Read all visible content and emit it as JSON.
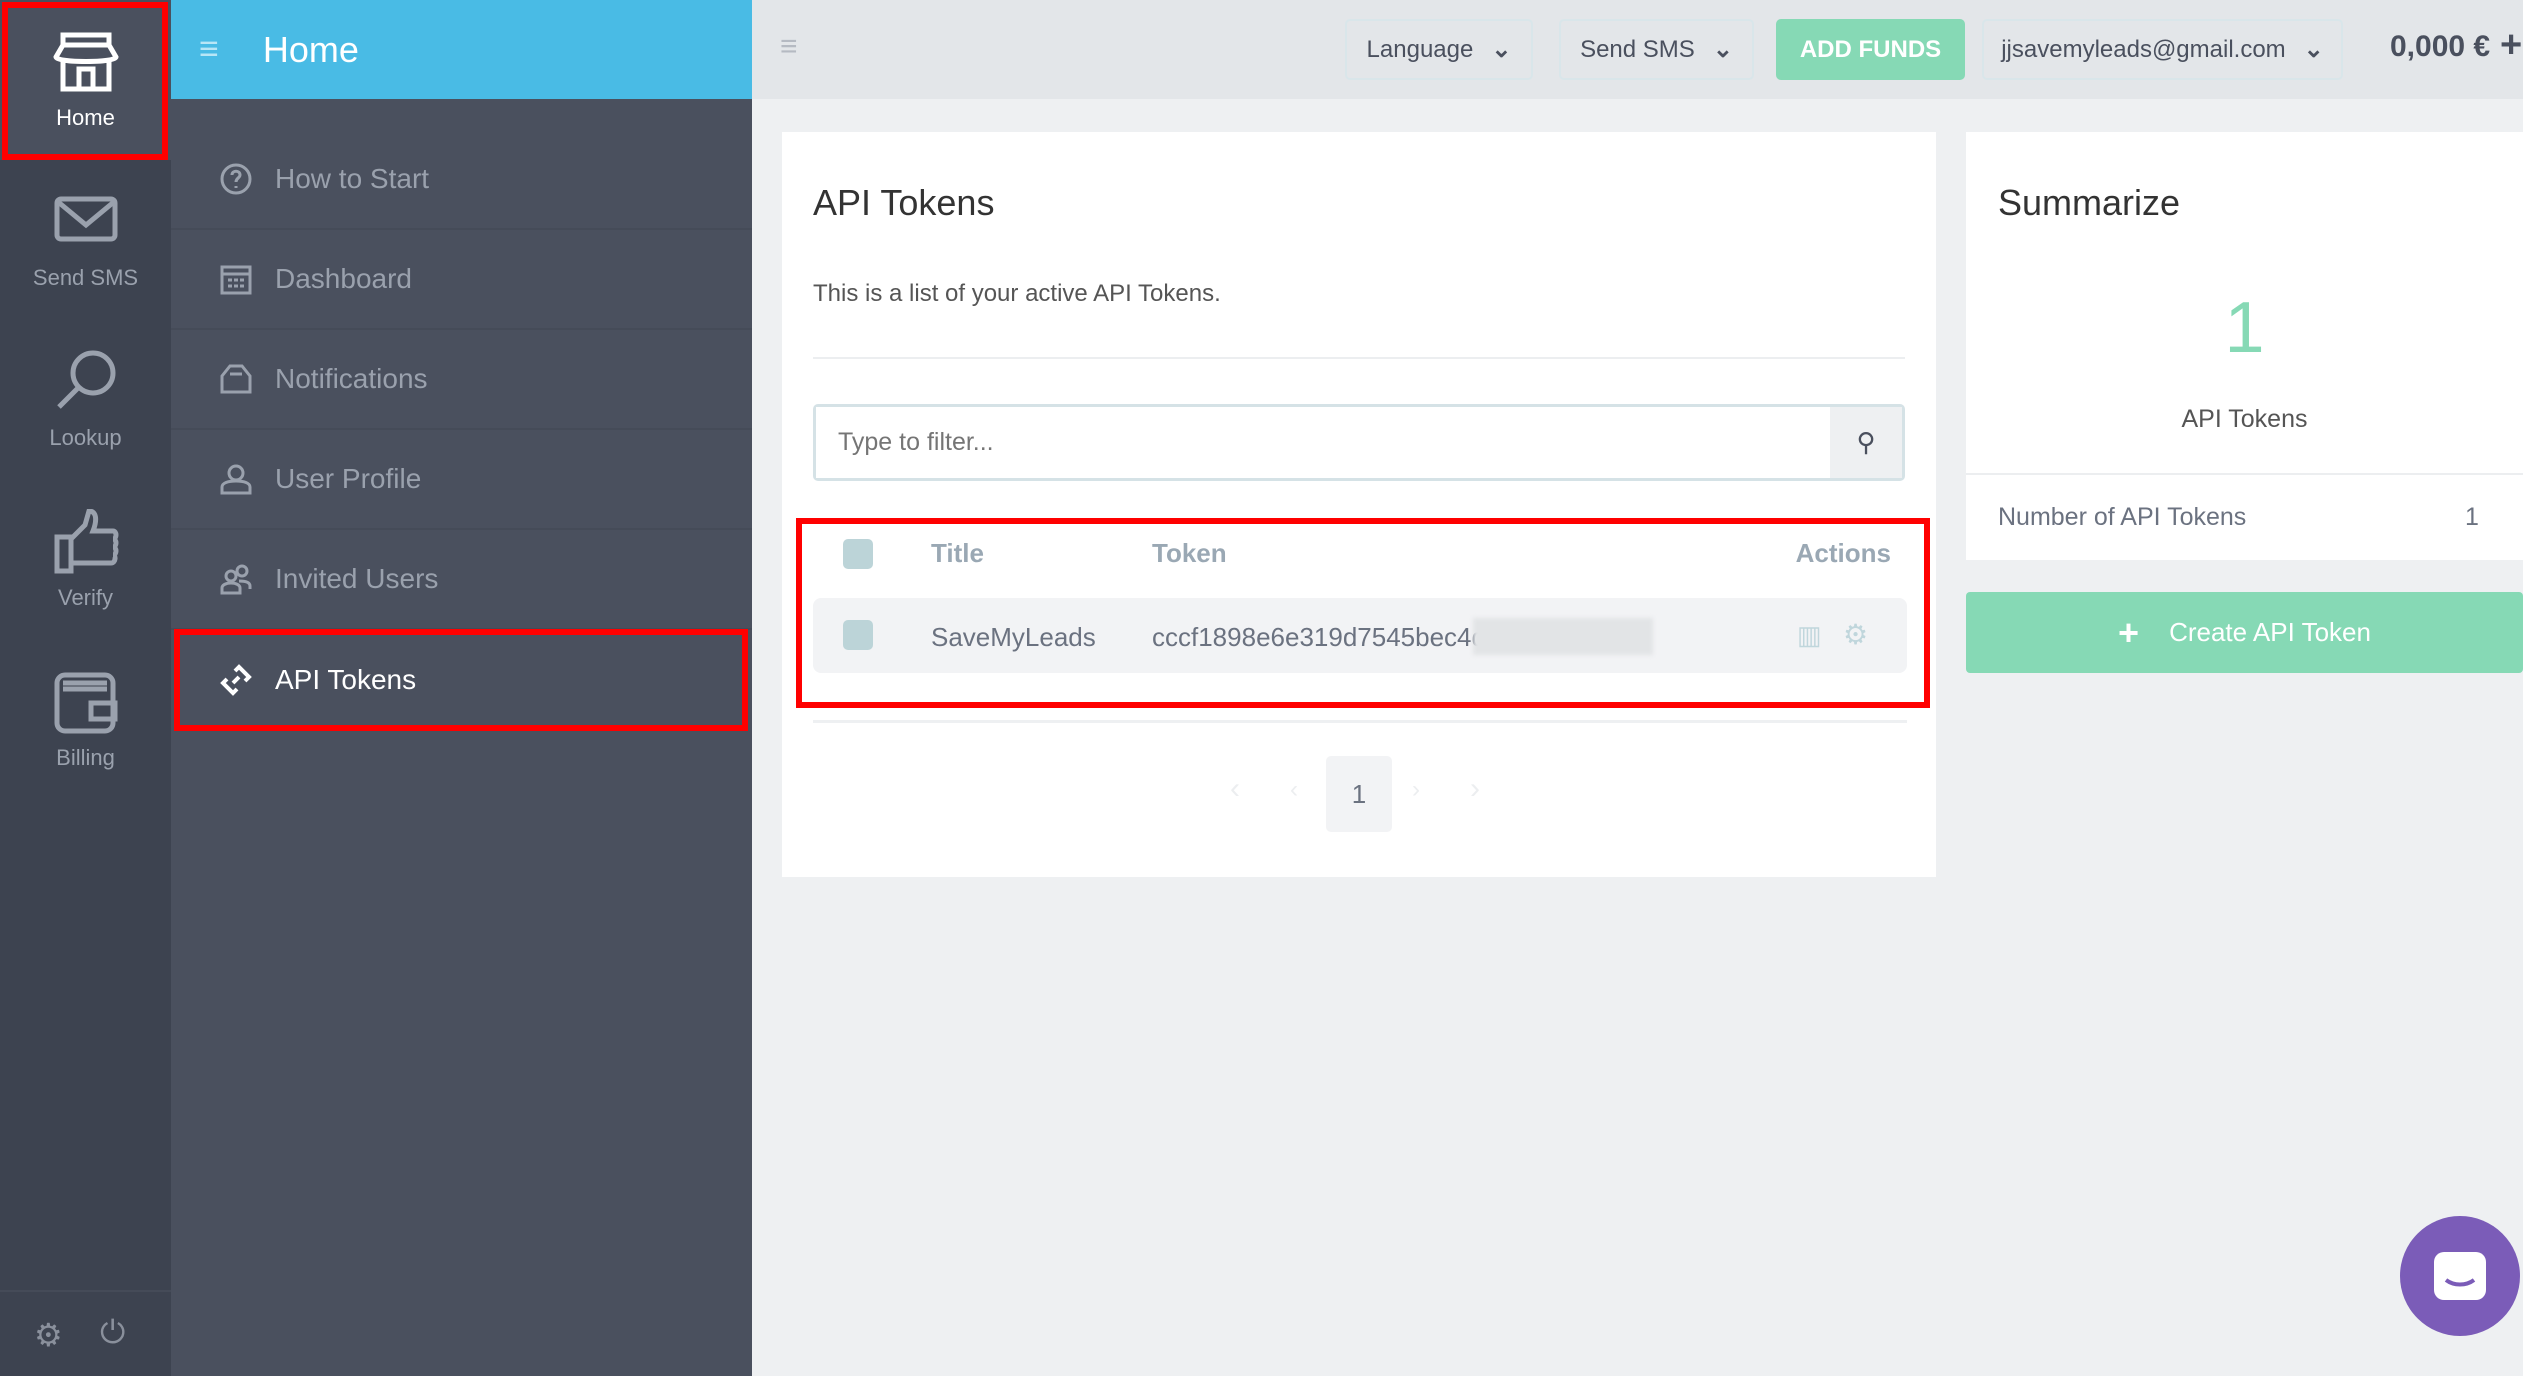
{
  "rail": {
    "items": [
      {
        "label": "Home"
      },
      {
        "label": "Send SMS"
      },
      {
        "label": "Lookup"
      },
      {
        "label": "Verify"
      },
      {
        "label": "Billing"
      }
    ]
  },
  "sidebar": {
    "title": "Home",
    "items": [
      {
        "label": "How to Start"
      },
      {
        "label": "Dashboard"
      },
      {
        "label": "Notifications"
      },
      {
        "label": "User Profile"
      },
      {
        "label": "Invited Users"
      },
      {
        "label": "API Tokens"
      }
    ]
  },
  "topbar": {
    "language": "Language",
    "send_sms": "Send SMS",
    "add_funds": "ADD FUNDS",
    "account": "jjsavemyleads@gmail.com",
    "balance": "0,000 €"
  },
  "main": {
    "title": "API Tokens",
    "description": "This is a list of your active API Tokens.",
    "filter_placeholder": "Type to filter...",
    "columns": {
      "title": "Title",
      "token": "Token",
      "actions": "Actions"
    },
    "rows": [
      {
        "title": "SaveMyLeads",
        "token": "cccf1898e6e319d7545bec4dfd6c"
      }
    ],
    "page": "1"
  },
  "summary": {
    "title": "Summarize",
    "count": "1",
    "count_label": "API Tokens",
    "stat_label": "Number of API Tokens",
    "stat_value": "1",
    "create_label": "Create API Token"
  },
  "colors": {
    "accent": "#49bbe5",
    "green": "#86d9b5",
    "sidebar": "#4a505e"
  }
}
